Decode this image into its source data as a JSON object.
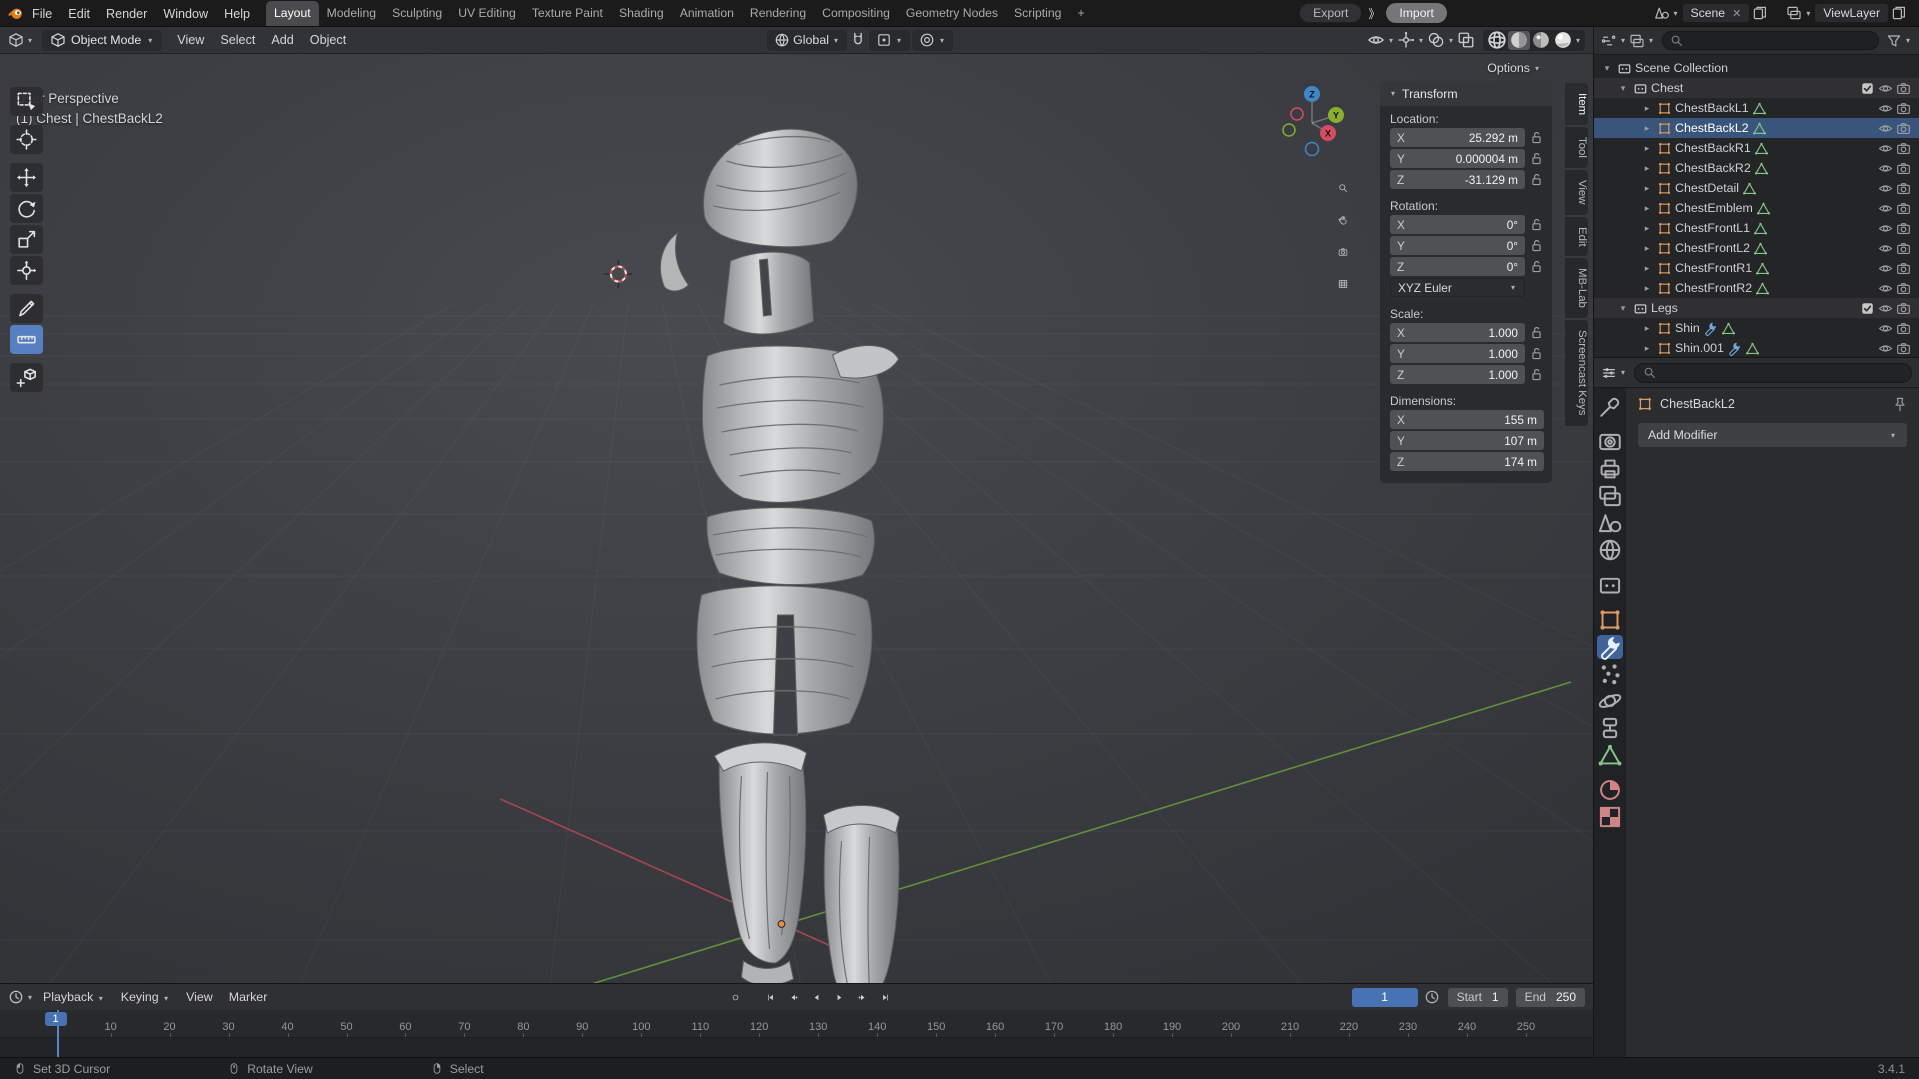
{
  "colors": {
    "accent": "#4772b3",
    "axis_x": "#d54d5e",
    "axis_y": "#8aae2e",
    "axis_z": "#3f87c7",
    "object_orange": "#dd9b5e",
    "mesh_green": "#86c787",
    "modifier_blue": "#6fa8dc"
  },
  "topbar": {
    "menus": [
      "File",
      "Edit",
      "Render",
      "Window",
      "Help"
    ],
    "workspaces": [
      "Layout",
      "Modeling",
      "Sculpting",
      "UV Editing",
      "Texture Paint",
      "Shading",
      "Animation",
      "Rendering",
      "Compositing",
      "Geometry Nodes",
      "Scripting"
    ],
    "active_workspace": "Layout",
    "add_tab": "+",
    "export_button": "Export",
    "chevrons": "》",
    "import_button": "Import",
    "scene_field": "Scene",
    "view_layer_field": "ViewLayer"
  },
  "viewport": {
    "header": {
      "mode_label": "Object Mode",
      "menus": [
        "View",
        "Select",
        "Add",
        "Object"
      ],
      "orientation_label": "Global",
      "options_label": "Options"
    },
    "overlay": {
      "line1": "User Perspective",
      "line2": "(1) Chest | ChestBackL2"
    },
    "tools": [
      {
        "name": "select-box-tool",
        "active": false
      },
      {
        "name": "cursor-tool",
        "active": false
      },
      {
        "name": "move-tool",
        "active": false
      },
      {
        "name": "rotate-tool",
        "active": false
      },
      {
        "name": "scale-tool",
        "active": false
      },
      {
        "name": "transform-tool",
        "active": false
      },
      {
        "name": "annotate-tool",
        "active": false
      },
      {
        "name": "measure-tool",
        "active": true
      },
      {
        "name": "add-cube-tool",
        "active": false
      }
    ],
    "sidebar_tabs": [
      {
        "label": "Item",
        "active": true
      },
      {
        "label": "Tool",
        "active": false
      },
      {
        "label": "View",
        "active": false
      },
      {
        "label": "Edit",
        "active": false
      },
      {
        "label": "MB-Lab",
        "active": false
      },
      {
        "label": "Screencast Keys",
        "active": false
      }
    ],
    "gizmo_axes": [
      "X",
      "Y",
      "Z"
    ]
  },
  "transform_panel": {
    "title": "Transform",
    "groups": [
      {
        "label": "Location:",
        "locks": true,
        "rows": [
          [
            "X",
            "25.292 m"
          ],
          [
            "Y",
            "0.000004 m"
          ],
          [
            "Z",
            "-31.129 m"
          ]
        ]
      },
      {
        "label": "Rotation:",
        "locks": true,
        "rows": [
          [
            "X",
            "0°"
          ],
          [
            "Y",
            "0°"
          ],
          [
            "Z",
            "0°"
          ]
        ],
        "dropdown": "XYZ Euler"
      },
      {
        "label": "Scale:",
        "locks": true,
        "rows": [
          [
            "X",
            "1.000"
          ],
          [
            "Y",
            "1.000"
          ],
          [
            "Z",
            "1.000"
          ]
        ]
      },
      {
        "label": "Dimensions:",
        "locks": false,
        "rows": [
          [
            "X",
            "155 m"
          ],
          [
            "Y",
            "107 m"
          ],
          [
            "Z",
            "174 m"
          ]
        ]
      }
    ]
  },
  "outliner": {
    "root_label": "Scene Collection",
    "collections": [
      {
        "name": "Chest",
        "objects": [
          {
            "name": "ChestBackL1"
          },
          {
            "name": "ChestBackL2",
            "selected": true
          },
          {
            "name": "ChestBackR1"
          },
          {
            "name": "ChestBackR2"
          },
          {
            "name": "ChestDetail"
          },
          {
            "name": "ChestEmblem"
          },
          {
            "name": "ChestFrontL1"
          },
          {
            "name": "ChestFrontL2"
          },
          {
            "name": "ChestFrontR1"
          },
          {
            "name": "ChestFrontR2"
          }
        ]
      },
      {
        "name": "Legs",
        "objects": [
          {
            "name": "Shin",
            "modifier": true
          },
          {
            "name": "Shin.001",
            "modifier": true
          }
        ]
      }
    ]
  },
  "properties": {
    "active_item": "ChestBackL2",
    "add_modifier_label": "Add Modifier",
    "tabs": [
      "tool",
      "render",
      "output",
      "view-layer",
      "scene",
      "world",
      "collection",
      "object",
      "modifiers",
      "particles",
      "physics",
      "constraints",
      "object-data",
      "material",
      "texture"
    ],
    "active_tab": "modifiers"
  },
  "timeline": {
    "menus": [
      "Playback",
      "Keying",
      "View",
      "Marker"
    ],
    "current_frame": "1",
    "start_label": "Start",
    "start_value": "1",
    "end_label": "End",
    "end_value": "250",
    "ticks": [
      10,
      20,
      30,
      40,
      50,
      60,
      70,
      80,
      90,
      100,
      110,
      120,
      130,
      140,
      150,
      160,
      170,
      180,
      190,
      200,
      210,
      220,
      230,
      240,
      250
    ]
  },
  "statusbar": {
    "hints": [
      {
        "button": "left",
        "label": "Set 3D Cursor"
      },
      {
        "button": "middle",
        "label": "Rotate View"
      },
      {
        "button": "right",
        "label": "Select"
      }
    ],
    "version": "3.4.1"
  }
}
